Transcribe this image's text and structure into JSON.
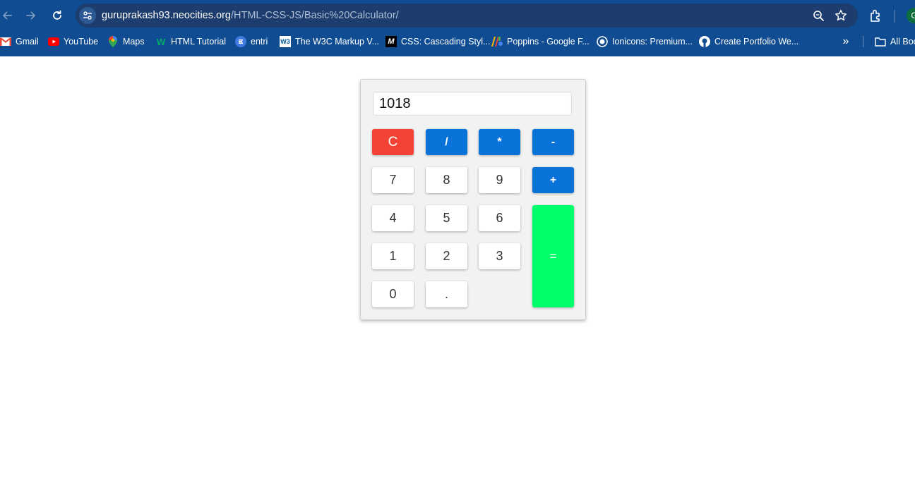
{
  "browser": {
    "url_host": "guruprakash93.neocities.org",
    "url_path": "/HTML-CSS-JS/Basic%20Calculator/",
    "profile_initial": "G",
    "bookmarks": [
      {
        "label": "Gmail",
        "icon": "gmail-icon"
      },
      {
        "label": "YouTube",
        "icon": "youtube-icon"
      },
      {
        "label": "Maps",
        "icon": "maps-icon"
      },
      {
        "label": "HTML Tutorial",
        "icon": "w3schools-icon"
      },
      {
        "label": "entri",
        "icon": "entri-icon"
      },
      {
        "label": "The W3C Markup V...",
        "icon": "w3c-icon"
      },
      {
        "label": "CSS: Cascading Styl...",
        "icon": "mdn-icon"
      },
      {
        "label": "Poppins - Google F...",
        "icon": "google-fonts-icon"
      },
      {
        "label": "Ionicons: Premium...",
        "icon": "ionicons-icon"
      },
      {
        "label": "Create Portfolio We...",
        "icon": "github-icon"
      }
    ],
    "all_bookmarks_label": "All Bookmarks"
  },
  "calculator": {
    "display_value": "1018",
    "keys": {
      "clear": "C",
      "divide": "/",
      "multiply": "*",
      "subtract": "-",
      "seven": "7",
      "eight": "8",
      "nine": "9",
      "add": "+",
      "four": "4",
      "five": "5",
      "six": "6",
      "one": "1",
      "two": "2",
      "three": "3",
      "equals": "=",
      "zero": "0",
      "decimal": "."
    },
    "colors": {
      "clear": "#f44336",
      "operator": "#0a73d9",
      "equals": "#00ff6a",
      "digit": "#ffffff"
    }
  }
}
